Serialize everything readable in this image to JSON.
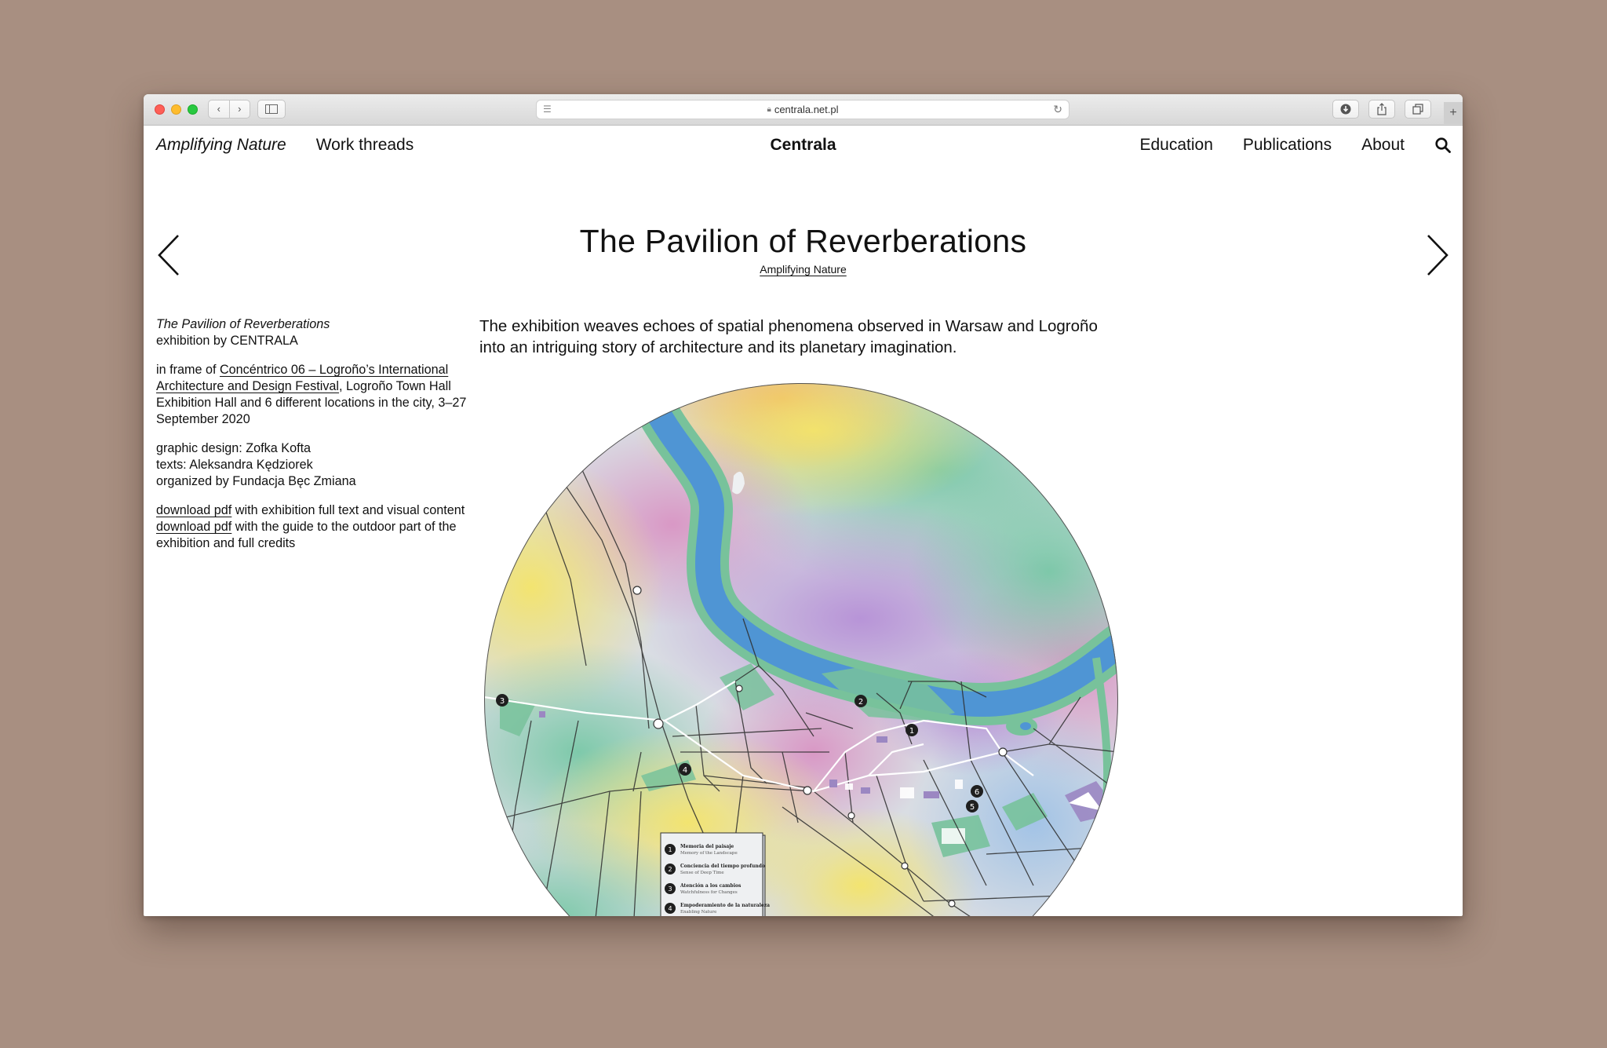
{
  "browser": {
    "url": "centrala.net.pl",
    "nav_back": "‹",
    "nav_forward": "›",
    "new_tab": "+"
  },
  "site": {
    "nav_left": [
      "Amplifying Nature",
      "Work threads"
    ],
    "brand": "Centrala",
    "nav_right": [
      "Education",
      "Publications",
      "About"
    ]
  },
  "project": {
    "title": "The Pavilion of Reverberations",
    "category": "Amplifying Nature",
    "info": {
      "name": "The Pavilion of Reverberations",
      "exhibition_by": "exhibition by CENTRALA",
      "frame_prefix": "in frame of ",
      "frame_link": "Concéntrico 06 – Logroño’s International Architecture and Design Festival",
      "frame_suffix": ", Logroño Town Hall Exhibition Hall and 6 different locations in the city, 3–27 September 2020",
      "graphic_design": "graphic design: Zofka Kofta",
      "texts": "texts: Aleksandra Kędziorek",
      "organized": "organized by Fundacja Bęc Zmiana",
      "download1_link": "download pdf",
      "download1_text": " with exhibition full text and visual content",
      "download2_link": "download pdf",
      "download2_text": " with the guide to the outdoor part of the exhibition and full credits"
    },
    "lede": "The exhibition weaves echoes of spatial phenomena observed in Warsaw and Logroño into an intriguing story of architecture and its planetary imagination."
  },
  "map": {
    "markers": [
      "1",
      "2",
      "3",
      "4",
      "5",
      "6"
    ],
    "legend": [
      {
        "num": "1",
        "title": "Memoria del paisaje",
        "subtitle": "Memory of the Landscape"
      },
      {
        "num": "2",
        "title": "Conciencia del tiempo profundo",
        "subtitle": "Sense of Deep Time"
      },
      {
        "num": "3",
        "title": "Atención a los cambios",
        "subtitle": "Watchfulness for Changes"
      },
      {
        "num": "4",
        "title": "Empoderamiento de la naturaleza",
        "subtitle": "Enabling Nature"
      }
    ],
    "colors": {
      "river": "#4f95d4",
      "green": "#78c29b",
      "building": "#9b87c2"
    }
  }
}
